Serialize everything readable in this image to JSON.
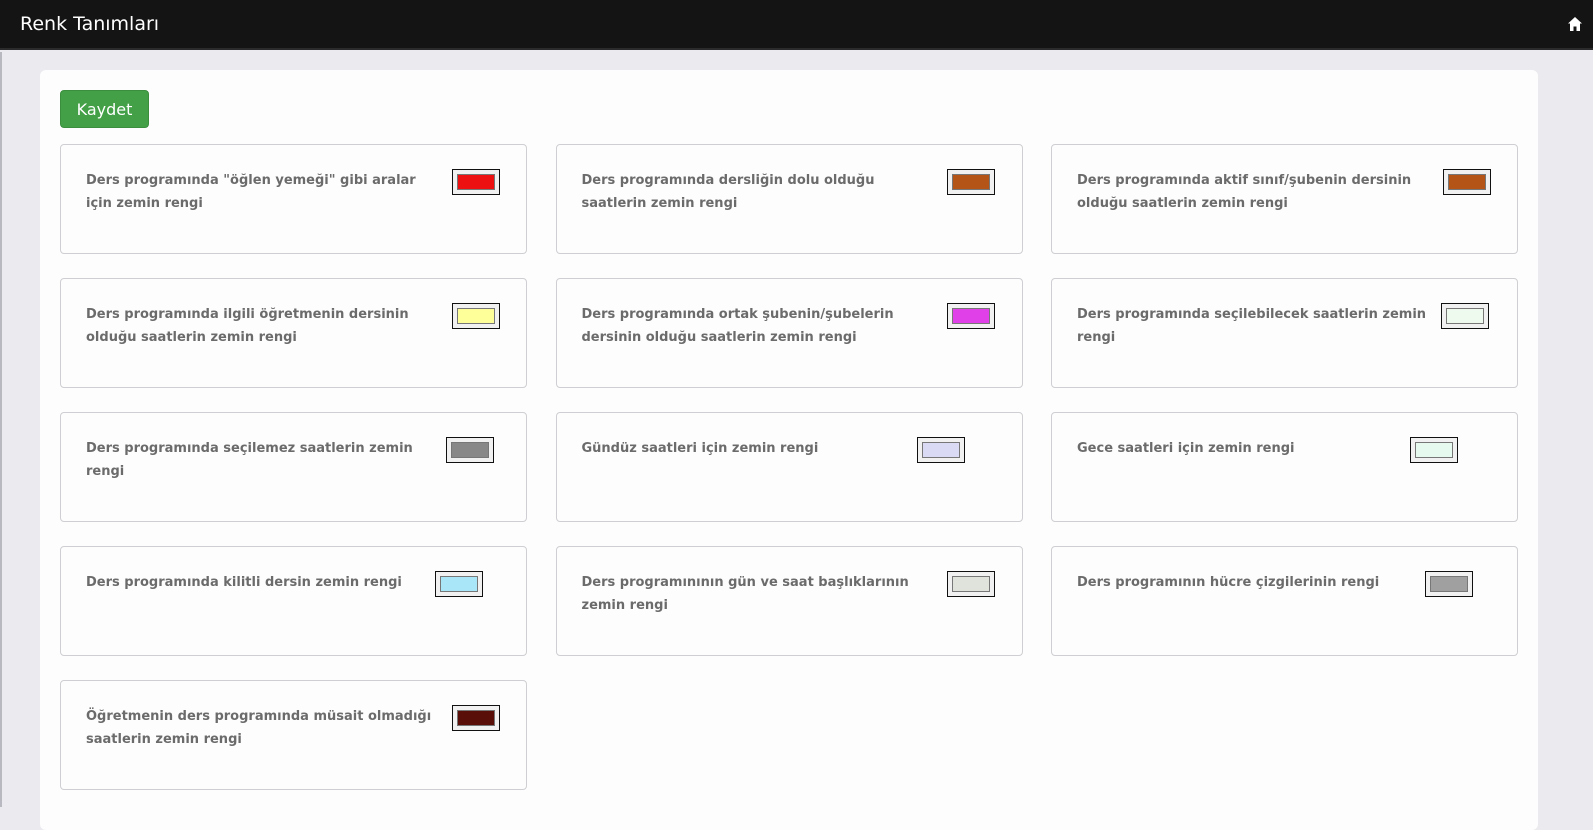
{
  "header": {
    "title": "Renk Tanımları",
    "home_icon": "home-icon"
  },
  "toolbar": {
    "save_label": "Kaydet",
    "save_color": "#43a047"
  },
  "colors": [
    {
      "label": "Ders programında \"öğlen yemeği\" gibi aralar için zemin rengi",
      "color": "#ee1111"
    },
    {
      "label": "Ders programında dersliğin dolu olduğu saatlerin zemin rengi",
      "color": "#b55417"
    },
    {
      "label": "Ders programında aktif sınıf/şubenin dersinin olduğu saatlerin zemin rengi",
      "color": "#b55417"
    },
    {
      "label": "Ders programında ilgili öğretmenin dersinin olduğu saatlerin zemin rengi",
      "color": "#ffff99"
    },
    {
      "label": "Ders programında ortak şubenin/şubelerin dersinin olduğu saatlerin zemin rengi",
      "color": "#e040e8"
    },
    {
      "label": "Ders programında seçilebilecek saatlerin zemin rengi",
      "color": "#eefaee"
    },
    {
      "label": "Ders programında seçilemez saatlerin zemin rengi",
      "color": "#888888"
    },
    {
      "label": "Gündüz saatleri için zemin rengi",
      "color": "#dadaf5"
    },
    {
      "label": "Gece saatleri için zemin rengi",
      "color": "#e6faf0"
    },
    {
      "label": "Ders programında kilitli dersin zemin rengi",
      "color": "#a8e6f8"
    },
    {
      "label": "Ders programınının gün ve saat başlıklarının zemin rengi",
      "color": "#e0e2dc"
    },
    {
      "label": "Ders programının hücre çizgilerinin rengi",
      "color": "#a0a0a0"
    },
    {
      "label": "Öğretmenin ders programında müsait olmadığı saatlerin zemin rengi",
      "color": "#5a0e08"
    }
  ]
}
